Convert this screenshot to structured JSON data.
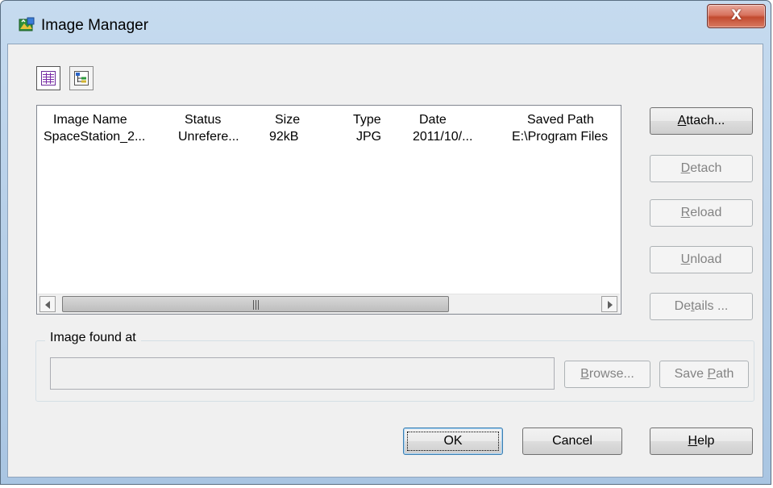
{
  "window": {
    "title": "Image Manager",
    "close_glyph": "X"
  },
  "toolbar": {
    "list_view_icon": "list-view-icon",
    "tree_view_icon": "tree-view-icon"
  },
  "table": {
    "columns": [
      "Image Name",
      "Status",
      "Size",
      "Type",
      "Date",
      "Saved Path"
    ],
    "rows": [
      [
        "SpaceStation_2...",
        "Unrefere...",
        "92kB",
        "JPG",
        "2011/10/...",
        "E:\\Program Files"
      ]
    ]
  },
  "side_buttons": {
    "attach": {
      "pre": "",
      "key": "A",
      "post": "ttach..."
    },
    "detach": {
      "pre": "",
      "key": "D",
      "post": "etach"
    },
    "reload": {
      "pre": "",
      "key": "R",
      "post": "eload"
    },
    "unload": {
      "pre": "",
      "key": "U",
      "post": "nload"
    },
    "details": {
      "pre": "De",
      "key": "t",
      "post": "ails ..."
    }
  },
  "found_at": {
    "label": "Image found at",
    "value": "",
    "browse": {
      "pre": "",
      "key": "B",
      "post": "rowse..."
    },
    "save_path": {
      "pre": "Save ",
      "key": "P",
      "post": "ath"
    }
  },
  "footer": {
    "ok": "OK",
    "cancel": "Cancel",
    "help": {
      "pre": "",
      "key": "H",
      "post": "elp"
    }
  },
  "colors": {
    "title_gradient": "#b9d1e9",
    "close_button": "#c24a2f",
    "dialog_bg": "#f0f0f0",
    "disabled_text": "#838383"
  }
}
